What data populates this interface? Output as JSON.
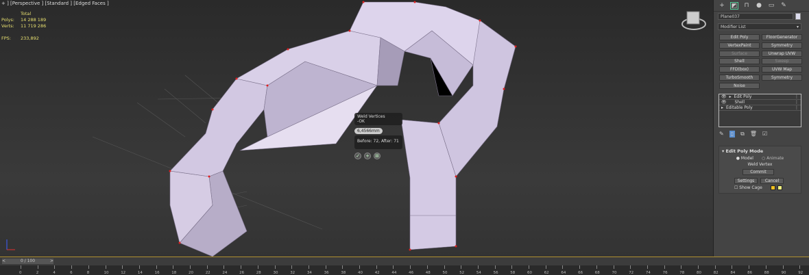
{
  "viewport": {
    "label": "+ ] [Perspective ] [Standard ] [Edged Faces ]",
    "stats": {
      "header": "Total",
      "polys_label": "Polys:",
      "polys": "14 288 189",
      "verts_label": "Verts:",
      "verts": "11 719 286",
      "fps_label": "FPS:",
      "fps": "233,892"
    }
  },
  "caddy": {
    "title": "Weld Vertices",
    "status": "-OK",
    "threshold": "6,4566mm",
    "result": "Before: 72, After: 71",
    "buttons": [
      "ok",
      "apply-continue",
      "pin"
    ]
  },
  "panel": {
    "tabs": [
      "create",
      "modify",
      "hierarchy",
      "motion",
      "display",
      "utilities"
    ],
    "object_name": "Plane037",
    "modifier_list": "Modifier List",
    "modifier_buttons": [
      [
        "Edit Poly",
        "FloorGenerator"
      ],
      [
        "VertexPaint",
        "Symmetry"
      ],
      [
        "Surface",
        "Unwrap UVW"
      ],
      [
        "Shell",
        "Sweep"
      ],
      [
        "FFD(box)",
        "UVW Map"
      ],
      [
        "TurboSmooth",
        "Symmetry"
      ],
      [
        "Noise",
        ""
      ]
    ],
    "stack": [
      "Edit Poly",
      "Shell",
      "Editable Poly"
    ],
    "rollout": {
      "title": "Edit Poly Mode",
      "model": "Model",
      "animate": "Animate",
      "op": "Weld Vertex",
      "commit": "Commit",
      "settings": "Settings",
      "cancel": "Cancel",
      "show_cage": "Show Cage",
      "cage_colors": [
        "#f0c020",
        "#f0f080"
      ]
    }
  },
  "timeline": {
    "frame": "0 / 100",
    "ticks": [
      0,
      2,
      4,
      6,
      8,
      10,
      12,
      14,
      16,
      18,
      20,
      22,
      24,
      26,
      28,
      30,
      32,
      34,
      36,
      38,
      40,
      42,
      44,
      46,
      48,
      50,
      52,
      54,
      56,
      58,
      60,
      62,
      64,
      66,
      68,
      70,
      72,
      74,
      76,
      78,
      80,
      82,
      84,
      86,
      88,
      90,
      92
    ]
  }
}
